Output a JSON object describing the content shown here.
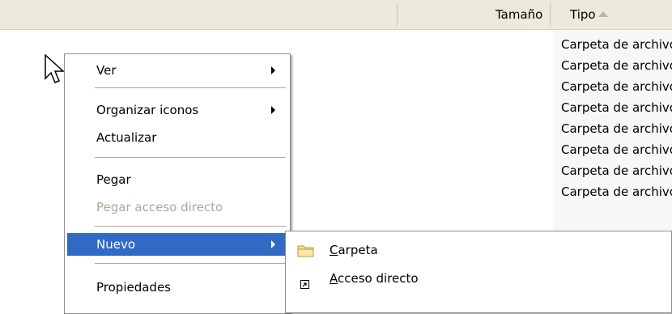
{
  "header": {
    "size_label": "Tamaño",
    "type_label": "Tipo",
    "sort_icon": "sort-ascending-icon"
  },
  "type_column": {
    "rows": [
      "Carpeta de archivos",
      "Carpeta de archivos",
      "Carpeta de archivos",
      "Carpeta de archivos",
      "Carpeta de archivos",
      "Carpeta de archivos",
      "Carpeta de archivos",
      "Carpeta de archivos"
    ]
  },
  "context_menu": {
    "items": [
      {
        "label": "Ver",
        "has_submenu": true,
        "enabled": true
      },
      {
        "label": "Organizar iconos",
        "has_submenu": true,
        "enabled": true
      },
      {
        "label": "Actualizar",
        "has_submenu": false,
        "enabled": true
      },
      {
        "label": "Pegar",
        "has_submenu": false,
        "enabled": true
      },
      {
        "label": "Pegar acceso directo",
        "has_submenu": false,
        "enabled": false
      },
      {
        "label": "Nuevo",
        "has_submenu": true,
        "enabled": true,
        "selected": true
      },
      {
        "label": "Propiedades",
        "has_submenu": false,
        "enabled": true
      }
    ]
  },
  "submenu_nuevo": {
    "items": [
      {
        "accel": "C",
        "rest": "arpeta",
        "icon": "folder-icon"
      },
      {
        "accel": "A",
        "rest": "cceso directo",
        "icon": "shortcut-icon"
      }
    ]
  },
  "colors": {
    "header_bg": "#ebeadb",
    "menu_highlight": "#316ac5",
    "disabled_text": "#aca899",
    "sorted_column_bg": "#f7f7f7"
  }
}
